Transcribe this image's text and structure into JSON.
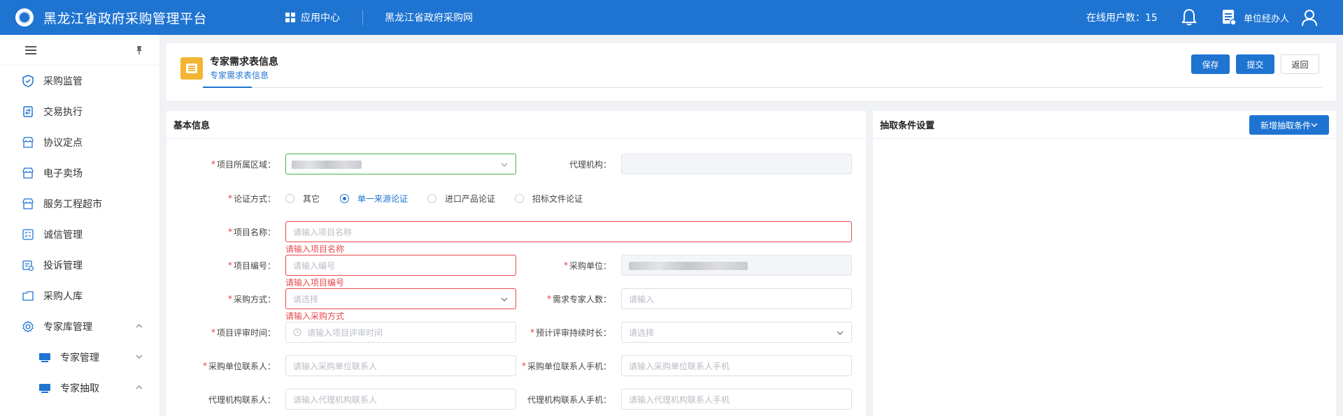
{
  "topbar": {
    "title": "黑龙江省政府采购管理平台",
    "app_center": "应用中心",
    "procurement_site": "黑龙江省政府采购网",
    "online_users": "在线用户数：15",
    "user_role": "单位经办人"
  },
  "sidebar": {
    "items": [
      {
        "label": "采购监管",
        "icon": "shield-icon"
      },
      {
        "label": "交易执行",
        "icon": "exchange-doc-icon"
      },
      {
        "label": "协议定点",
        "icon": "store-icon"
      },
      {
        "label": "电子卖场",
        "icon": "store-icon"
      },
      {
        "label": "服务工程超市",
        "icon": "store-icon"
      },
      {
        "label": "诚信管理",
        "icon": "list-icon"
      },
      {
        "label": "投诉管理",
        "icon": "complaint-icon"
      },
      {
        "label": "采购人库",
        "icon": "folder-icon"
      },
      {
        "label": "专家库管理",
        "icon": "gear-icon",
        "expanded": true
      },
      {
        "label": "专家管理",
        "icon": "monitor-icon",
        "expanded": false
      },
      {
        "label": "专家抽取",
        "icon": "monitor-icon",
        "expanded": true
      }
    ]
  },
  "header": {
    "title": "专家需求表信息",
    "tab": "专家需求表信息",
    "save": "保存",
    "submit": "提交",
    "back": "返回"
  },
  "basic": {
    "title": "基本信息",
    "region_label": "项目所属区域：",
    "agency_label": "代理机构：",
    "method_label": "论证方式：",
    "radios": [
      "其它",
      "单一来源论证",
      "进口产品论证",
      "招标文件论证"
    ],
    "radio_selected": 1,
    "name_label": "项目名称：",
    "name_placeholder": "请输入项目名称",
    "name_error": "请输入项目名称",
    "code_label": "项目编号：",
    "code_placeholder": "请输入编号",
    "code_error": "请输入项目编号",
    "unit_label": "采购单位：",
    "mode_label": "采购方式：",
    "mode_placeholder": "请选择",
    "mode_error": "请输入采购方式",
    "experts_label": "需求专家人数：",
    "experts_placeholder": "请输入",
    "time_label": "项目评审时间：",
    "time_placeholder": "请输入项目评审时间",
    "duration_label": "预计评审持续时长：",
    "duration_placeholder": "请选择",
    "contact_label": "采购单位联系人：",
    "contact_placeholder": "请输入采购单位联系人",
    "phone_label": "采购单位联系人手机：",
    "phone_placeholder": "请输入采购单位联系人手机",
    "agent_contact_label": "代理机构联系人：",
    "agent_contact_placeholder": "请输入代理机构联系人",
    "agent_phone_label": "代理机构联系人手机：",
    "agent_phone_placeholder": "请输入代理机构联系人手机"
  },
  "extract": {
    "title": "抽取条件设置",
    "add_button": "新增抽取条件"
  },
  "colors": {
    "primary": "#1f74d2",
    "error": "#e8484d",
    "success": "#43b54a",
    "header_icon": "#f3b533"
  }
}
